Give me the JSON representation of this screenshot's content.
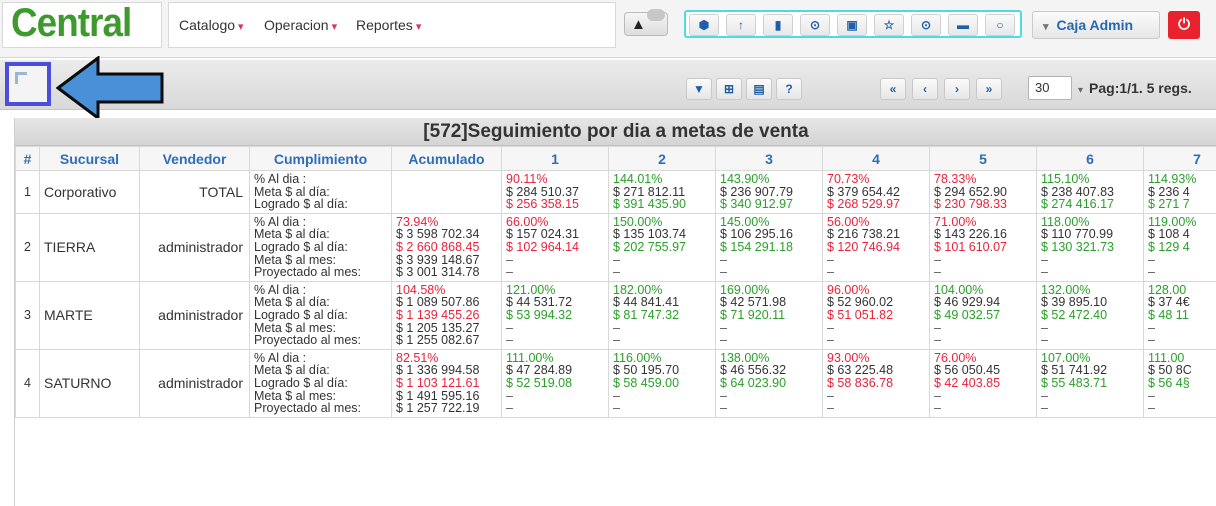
{
  "app": {
    "logo": "Central",
    "menu": [
      {
        "label": "Catalogo",
        "caret": "▾"
      },
      {
        "label": "Operacion",
        "caret": "▾"
      },
      {
        "label": "Reportes",
        "caret": "▾"
      }
    ],
    "icons": [
      "cube-icon",
      "pin-icon",
      "shield-icon",
      "clock-icon",
      "ticket-icon",
      "star-icon",
      "target-icon",
      "card-icon",
      "circle-icon"
    ],
    "icon_glyphs": [
      "⬢",
      "↑",
      "▮",
      "⊙",
      "▣",
      "☆",
      "⊙",
      "▬",
      "○"
    ],
    "alert_glyph": "▲",
    "user_caret": "▾",
    "user": "Caja Admin",
    "power_glyph": "⏻"
  },
  "toolbar": {
    "buttons": [
      {
        "name": "filter-icon",
        "glyph": "▼"
      },
      {
        "name": "export-icon",
        "glyph": "⊞"
      },
      {
        "name": "columns-icon",
        "glyph": "▤"
      },
      {
        "name": "help-icon",
        "glyph": "?"
      },
      {
        "name": "first-page-icon",
        "glyph": "«"
      },
      {
        "name": "prev-page-icon",
        "glyph": "‹"
      },
      {
        "name": "next-page-icon",
        "glyph": "›"
      },
      {
        "name": "last-page-icon",
        "glyph": "»"
      }
    ],
    "page_size": "30",
    "page_caret": "▾",
    "page_info": "Pag:1/1. 5 regs."
  },
  "colors": {
    "accent": "#2e6db8",
    "red": "#e8233a",
    "green": "#2aa02a",
    "logo": "#3e9a2e",
    "highlight": "#4a4ed8",
    "arrow": "#4a90d9"
  },
  "table": {
    "title": "[572]Seguimiento por dia a metas de venta",
    "headers": [
      "#",
      "Sucursal",
      "Vendedor",
      "Cumplimiento",
      "Acumulado",
      "1",
      "2",
      "3",
      "4",
      "5",
      "6",
      "7"
    ],
    "rows": [
      {
        "num": "1",
        "sucursal": "Corporativo",
        "vendedor": "TOTAL",
        "labels": [
          "% Al dia :",
          "Meta $ al día:",
          "Logrado $ al día:"
        ],
        "acumulado": [],
        "days": [
          [
            [
              "90.11%",
              "red"
            ],
            [
              "$ 284 510.37",
              "dark"
            ],
            [
              "$ 256 358.15",
              "red"
            ]
          ],
          [
            [
              "144.01%",
              "green"
            ],
            [
              "$ 271 812.11",
              "dark"
            ],
            [
              "$ 391 435.90",
              "green"
            ]
          ],
          [
            [
              "143.90%",
              "green"
            ],
            [
              "$ 236 907.79",
              "dark"
            ],
            [
              "$ 340 912.97",
              "green"
            ]
          ],
          [
            [
              "70.73%",
              "red"
            ],
            [
              "$ 379 654.42",
              "dark"
            ],
            [
              "$ 268 529.97",
              "red"
            ]
          ],
          [
            [
              "78.33%",
              "red"
            ],
            [
              "$ 294 652.90",
              "dark"
            ],
            [
              "$ 230 798.33",
              "red"
            ]
          ],
          [
            [
              "115.10%",
              "green"
            ],
            [
              "$ 238 407.83",
              "dark"
            ],
            [
              "$ 274 416.17",
              "green"
            ]
          ],
          [
            [
              "114.93%",
              "green"
            ],
            [
              "$ 236 4",
              "dark"
            ],
            [
              "$ 271 7",
              "green"
            ]
          ]
        ]
      },
      {
        "num": "2",
        "sucursal": "TIERRA",
        "vendedor": "administrador",
        "labels": [
          "% Al dia :",
          "Meta $ al día:",
          "Logrado $ al día:",
          "Meta $ al mes:",
          "Proyectado al mes:"
        ],
        "acumulado": [
          [
            "73.94%",
            "red"
          ],
          [
            "$ 3 598 702.34",
            "dark"
          ],
          [
            "$ 2 660 868.45",
            "red"
          ],
          [
            "$ 3 939 148.67",
            "dark"
          ],
          [
            "$ 3 001 314.78",
            "dark"
          ]
        ],
        "days": [
          [
            [
              "66.00%",
              "red"
            ],
            [
              "$ 157 024.31",
              "dark"
            ],
            [
              "$ 102 964.14",
              "red"
            ],
            [
              "–",
              "dash"
            ],
            [
              "–",
              "dash"
            ]
          ],
          [
            [
              "150.00%",
              "green"
            ],
            [
              "$ 135 103.74",
              "dark"
            ],
            [
              "$ 202 755.97",
              "green"
            ],
            [
              "–",
              "dash"
            ],
            [
              "–",
              "dash"
            ]
          ],
          [
            [
              "145.00%",
              "green"
            ],
            [
              "$ 106 295.16",
              "dark"
            ],
            [
              "$ 154 291.18",
              "green"
            ],
            [
              "–",
              "dash"
            ],
            [
              "–",
              "dash"
            ]
          ],
          [
            [
              "56.00%",
              "red"
            ],
            [
              "$ 216 738.21",
              "dark"
            ],
            [
              "$ 120 746.94",
              "red"
            ],
            [
              "–",
              "dash"
            ],
            [
              "–",
              "dash"
            ]
          ],
          [
            [
              "71.00%",
              "red"
            ],
            [
              "$ 143 226.16",
              "dark"
            ],
            [
              "$ 101 610.07",
              "red"
            ],
            [
              "–",
              "dash"
            ],
            [
              "–",
              "dash"
            ]
          ],
          [
            [
              "118.00%",
              "green"
            ],
            [
              "$ 110 770.99",
              "dark"
            ],
            [
              "$ 130 321.73",
              "green"
            ],
            [
              "–",
              "dash"
            ],
            [
              "–",
              "dash"
            ]
          ],
          [
            [
              "119.00%",
              "green"
            ],
            [
              "$ 108 4",
              "dark"
            ],
            [
              "$ 129 4",
              "green"
            ],
            [
              "–",
              "dash"
            ],
            [
              "–",
              "dash"
            ]
          ]
        ]
      },
      {
        "num": "3",
        "sucursal": "MARTE",
        "vendedor": "administrador",
        "labels": [
          "% Al dia :",
          "Meta $ al día:",
          "Logrado $ al día:",
          "Meta $ al mes:",
          "Proyectado al mes:"
        ],
        "acumulado": [
          [
            "104.58%",
            "red"
          ],
          [
            "$ 1 089 507.86",
            "dark"
          ],
          [
            "$ 1 139 455.26",
            "red"
          ],
          [
            "$ 1 205 135.27",
            "dark"
          ],
          [
            "$ 1 255 082.67",
            "dark"
          ]
        ],
        "days": [
          [
            [
              "121.00%",
              "green"
            ],
            [
              "$ 44 531.72",
              "dark"
            ],
            [
              "$ 53 994.32",
              "green"
            ],
            [
              "–",
              "dash"
            ],
            [
              "–",
              "dash"
            ]
          ],
          [
            [
              "182.00%",
              "green"
            ],
            [
              "$ 44 841.41",
              "dark"
            ],
            [
              "$ 81 747.32",
              "green"
            ],
            [
              "–",
              "dash"
            ],
            [
              "–",
              "dash"
            ]
          ],
          [
            [
              "169.00%",
              "green"
            ],
            [
              "$ 42 571.98",
              "dark"
            ],
            [
              "$ 71 920.11",
              "green"
            ],
            [
              "–",
              "dash"
            ],
            [
              "–",
              "dash"
            ]
          ],
          [
            [
              "96.00%",
              "red"
            ],
            [
              "$ 52 960.02",
              "dark"
            ],
            [
              "$ 51 051.82",
              "red"
            ],
            [
              "–",
              "dash"
            ],
            [
              "–",
              "dash"
            ]
          ],
          [
            [
              "104.00%",
              "green"
            ],
            [
              "$ 46 929.94",
              "dark"
            ],
            [
              "$ 49 032.57",
              "green"
            ],
            [
              "–",
              "dash"
            ],
            [
              "–",
              "dash"
            ]
          ],
          [
            [
              "132.00%",
              "green"
            ],
            [
              "$ 39 895.10",
              "dark"
            ],
            [
              "$ 52 472.40",
              "green"
            ],
            [
              "–",
              "dash"
            ],
            [
              "–",
              "dash"
            ]
          ],
          [
            [
              "128.00",
              "green"
            ],
            [
              "$ 37 4€",
              "dark"
            ],
            [
              "$ 48 11",
              "green"
            ],
            [
              "–",
              "dash"
            ],
            [
              "–",
              "dash"
            ]
          ]
        ]
      },
      {
        "num": "4",
        "sucursal": "SATURNO",
        "vendedor": "administrador",
        "labels": [
          "% Al dia :",
          "Meta $ al día:",
          "Logrado $ al día:",
          "Meta $ al mes:",
          "Proyectado al mes:"
        ],
        "acumulado": [
          [
            "82.51%",
            "red"
          ],
          [
            "$ 1 336 994.58",
            "dark"
          ],
          [
            "$ 1 103 121.61",
            "red"
          ],
          [
            "$ 1 491 595.16",
            "dark"
          ],
          [
            "$ 1 257 722.19",
            "dark"
          ]
        ],
        "days": [
          [
            [
              "111.00%",
              "green"
            ],
            [
              "$ 47 284.89",
              "dark"
            ],
            [
              "$ 52 519.08",
              "green"
            ],
            [
              "–",
              "dash"
            ],
            [
              "–",
              "dash"
            ]
          ],
          [
            [
              "116.00%",
              "green"
            ],
            [
              "$ 50 195.70",
              "dark"
            ],
            [
              "$ 58 459.00",
              "green"
            ],
            [
              "–",
              "dash"
            ],
            [
              "–",
              "dash"
            ]
          ],
          [
            [
              "138.00%",
              "green"
            ],
            [
              "$ 46 556.32",
              "dark"
            ],
            [
              "$ 64 023.90",
              "green"
            ],
            [
              "–",
              "dash"
            ],
            [
              "–",
              "dash"
            ]
          ],
          [
            [
              "93.00%",
              "red"
            ],
            [
              "$ 63 225.48",
              "dark"
            ],
            [
              "$ 58 836.78",
              "red"
            ],
            [
              "–",
              "dash"
            ],
            [
              "–",
              "dash"
            ]
          ],
          [
            [
              "76.00%",
              "red"
            ],
            [
              "$ 56 050.45",
              "dark"
            ],
            [
              "$ 42 403.85",
              "red"
            ],
            [
              "–",
              "dash"
            ],
            [
              "–",
              "dash"
            ]
          ],
          [
            [
              "107.00%",
              "green"
            ],
            [
              "$ 51 741.92",
              "dark"
            ],
            [
              "$ 55 483.71",
              "green"
            ],
            [
              "–",
              "dash"
            ],
            [
              "–",
              "dash"
            ]
          ],
          [
            [
              "111.00",
              "green"
            ],
            [
              "$ 50 8C",
              "dark"
            ],
            [
              "$ 56 4§",
              "green"
            ],
            [
              "–",
              "dash"
            ],
            [
              "–",
              "dash"
            ]
          ]
        ]
      }
    ]
  }
}
